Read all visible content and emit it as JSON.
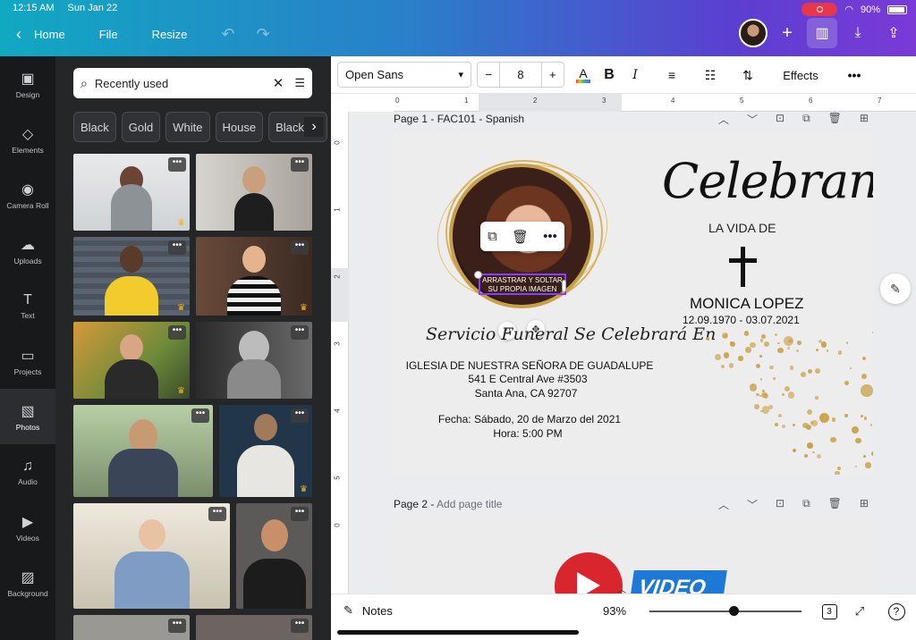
{
  "status": {
    "time": "12:15 AM",
    "date": "Sun Jan 22",
    "battery": "90%"
  },
  "nav": {
    "back_label": "Home",
    "file": "File",
    "resize": "Resize"
  },
  "rail": [
    {
      "label": "Design",
      "icon": "design-icon",
      "glyph": "▣"
    },
    {
      "label": "Elements",
      "icon": "elements-icon",
      "glyph": "◇"
    },
    {
      "label": "Camera Roll",
      "icon": "camera-icon",
      "glyph": "◉"
    },
    {
      "label": "Uploads",
      "icon": "upload-cloud-icon",
      "glyph": "☁"
    },
    {
      "label": "Text",
      "icon": "text-icon",
      "glyph": "T"
    },
    {
      "label": "Projects",
      "icon": "folder-icon",
      "glyph": "▭"
    },
    {
      "label": "Photos",
      "icon": "photo-icon",
      "glyph": "▧"
    },
    {
      "label": "Audio",
      "icon": "music-icon",
      "glyph": "♫"
    },
    {
      "label": "Videos",
      "icon": "video-icon",
      "glyph": "▶"
    },
    {
      "label": "Background",
      "icon": "background-icon",
      "glyph": "▨"
    }
  ],
  "search": {
    "value": "Recently used"
  },
  "chips": [
    "Black",
    "Gold",
    "White",
    "House",
    "Black ba"
  ],
  "toolbar": {
    "font": "Open Sans",
    "size": "8",
    "effects": "Effects"
  },
  "ruler_top": [
    "0",
    "1",
    "2",
    "3",
    "4",
    "5",
    "6",
    "7"
  ],
  "ruler_left": [
    "0",
    "1",
    "2",
    "3",
    "4",
    "5",
    "0"
  ],
  "page1": {
    "label": "Page 1 - FAC101 - Spanish",
    "celebrando": "Celebrando",
    "la_vida": "LA VIDA DE",
    "name": "MONICA LOPEZ",
    "dates": "12.09.1970 - 03.07.2021",
    "drag_text_1": "ARRASTRAR Y SOLTAR",
    "drag_text_2": "SU PROPIA IMAGEN",
    "servicio": "Servicio Funeral Se Celebrará En",
    "church_1": "IGLESIA DE NUESTRA SEÑORA DE GUADALUPE",
    "church_2": "541 E Central Ave #3503",
    "church_3": "Santa Ana, CA 92707",
    "fecha": "Fecha: Sábado, 20 de Marzo del 2021",
    "hora": "Hora: 5:00 PM"
  },
  "page2": {
    "label_prefix": "Page 2 - ",
    "label_placeholder": "Add page title",
    "video_text": "VIDEO"
  },
  "bottom": {
    "notes": "Notes",
    "zoom": "93%",
    "zoom_level": 0.55,
    "pages": "3",
    "help": "?"
  },
  "colors": {
    "accent": "#8b3dff",
    "gold": "#c9a24a",
    "topbar_start": "#11a8c2",
    "topbar_end": "#7a3ad6"
  }
}
